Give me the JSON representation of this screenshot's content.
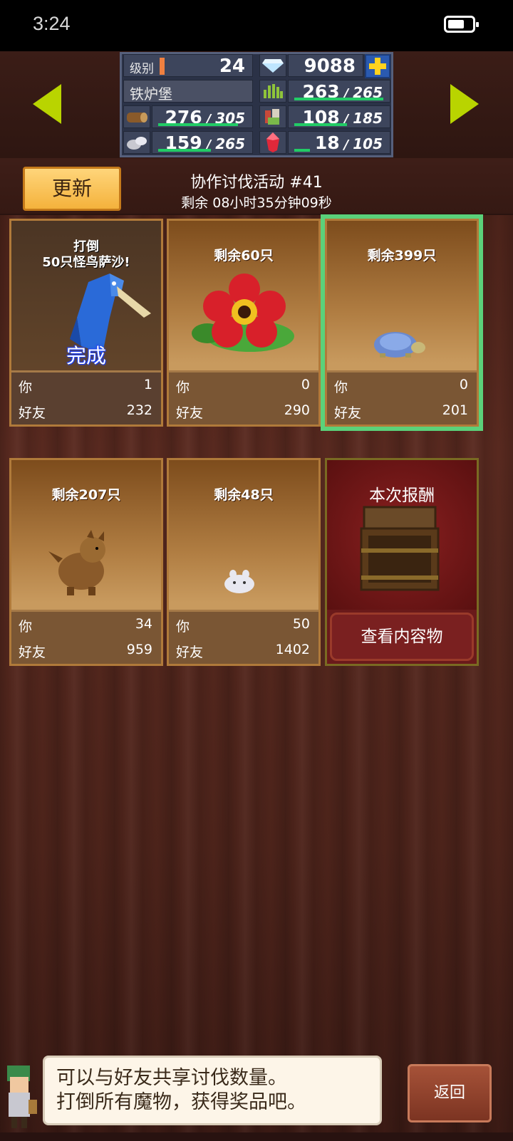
{
  "status_bar": {
    "time": "3:24"
  },
  "resources": {
    "level_label": "级别",
    "level": "24",
    "gems": "9088",
    "town_name": "铁炉堡",
    "grass": {
      "current": "263",
      "max": "265"
    },
    "wood": {
      "current": "276",
      "max": "305"
    },
    "food": {
      "current": "108",
      "max": "185"
    },
    "ore": {
      "current": "159",
      "max": "265"
    },
    "crystal": {
      "current": "18",
      "max": "105"
    }
  },
  "header": {
    "refresh_label": "更新",
    "event_title": "协作讨伐活动 #41",
    "remaining_time": "剩余 08小时35分钟09秒"
  },
  "cards": [
    {
      "title_line1": "打倒",
      "title_line2": "50只怪鸟萨沙!",
      "status": "完成",
      "you_label": "你",
      "you": "1",
      "friends_label": "好友",
      "friends": "232"
    },
    {
      "remaining": "剩余60只",
      "you_label": "你",
      "you": "0",
      "friends_label": "好友",
      "friends": "290"
    },
    {
      "remaining": "剩余399只",
      "you_label": "你",
      "you": "0",
      "friends_label": "好友",
      "friends": "201"
    },
    {
      "remaining": "剩余207只",
      "you_label": "你",
      "you": "34",
      "friends_label": "好友",
      "friends": "959"
    },
    {
      "remaining": "剩余48只",
      "you_label": "你",
      "you": "50",
      "friends_label": "好友",
      "friends": "1402"
    }
  ],
  "reward": {
    "title": "本次报酬",
    "view_button": "查看内容物"
  },
  "tip": {
    "line1": "可以与好友共享讨伐数量。",
    "line2": "打倒所有魔物，获得奖品吧。"
  },
  "back_button": "返回",
  "colors": {
    "accent_green": "#22cc66",
    "arrow": "#b9d400",
    "refresh_button": "#f4b23c",
    "selected_outline": "#5bd17a"
  }
}
